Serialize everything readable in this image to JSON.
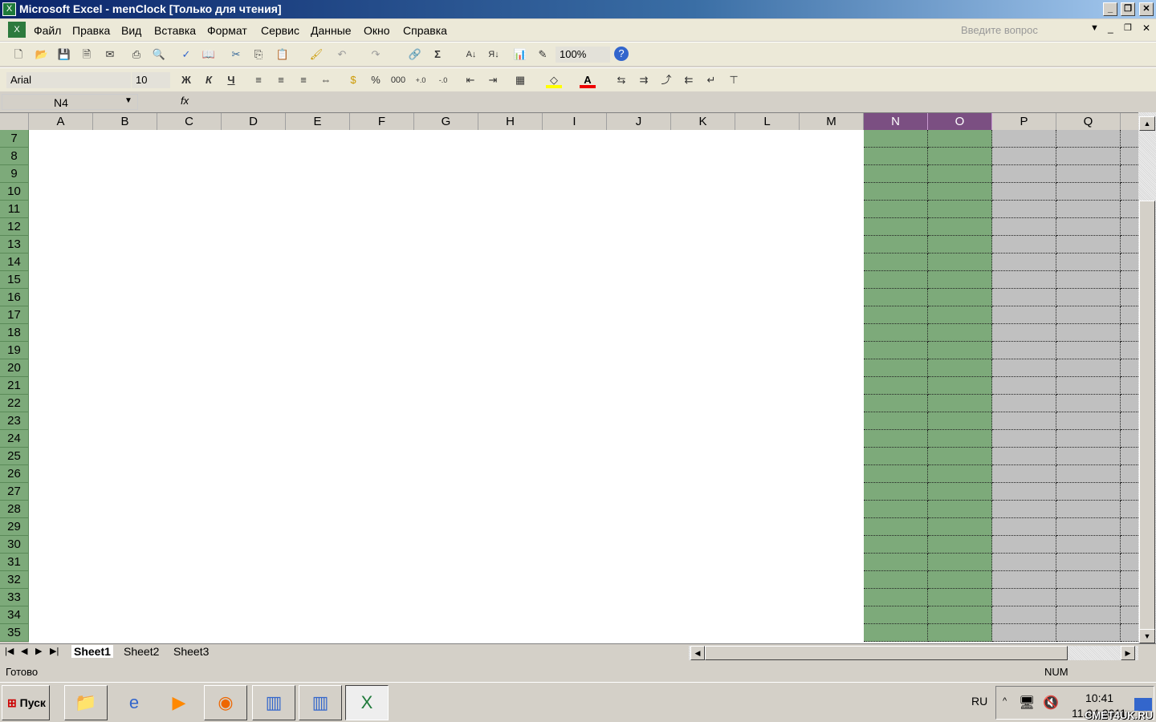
{
  "window": {
    "title": "Microsoft Excel - menClock  [Только для чтения]",
    "app_icon": "excel-icon",
    "minimize": "_",
    "restore": "❐",
    "close": "✕"
  },
  "menu": {
    "items": [
      "Файл",
      "Правка",
      "Вид",
      "Вставка",
      "Формат",
      "Сервис",
      "Данные",
      "Окно",
      "Справка"
    ],
    "help_placeholder": "Введите вопрос"
  },
  "toolbar_standard": {
    "zoom": "100%",
    "icons": [
      "new",
      "open",
      "save",
      "permission",
      "print-preview-email",
      "print",
      "print-preview",
      "spelling",
      "research",
      "cut",
      "copy",
      "paste",
      "format-painter",
      "undo",
      "redo",
      "hyperlink",
      "autosum",
      "sort-ascending",
      "sort-descending",
      "chart-wizard",
      "drawing",
      "help"
    ]
  },
  "toolbar_format": {
    "font": "Arial",
    "size": "10",
    "bold": "Ж",
    "italic": "К",
    "underline": "Ч",
    "percent": "%",
    "thousands": "000"
  },
  "formula_bar": {
    "name_box": "N4",
    "fx": "fx",
    "value": ""
  },
  "columns": [
    "A",
    "B",
    "C",
    "D",
    "E",
    "F",
    "G",
    "H",
    "I",
    "J",
    "K",
    "L",
    "M",
    "N",
    "O",
    "P",
    "Q"
  ],
  "selected_columns": [
    "N",
    "O"
  ],
  "rows": [
    7,
    8,
    9,
    10,
    11,
    12,
    13,
    14,
    15,
    16,
    17,
    18,
    19,
    20,
    21,
    22,
    23,
    24,
    25,
    26,
    27,
    28,
    29,
    30,
    31,
    32,
    33,
    34,
    35
  ],
  "colors": {
    "selected_fill": "#7daa7a",
    "header_selected": "#7b4f82",
    "out_of_range_fill": "#c0c0c0"
  },
  "sheets": {
    "tabs": [
      "Sheet1",
      "Sheet2",
      "Sheet3"
    ],
    "active": "Sheet1"
  },
  "status": {
    "text": "Готово",
    "num": "NUM"
  },
  "taskbar": {
    "start": "Пуск",
    "lang": "RU",
    "time": "10:41",
    "date": "11.04.2011",
    "watermark": "СМЕТ4UK.RU"
  }
}
